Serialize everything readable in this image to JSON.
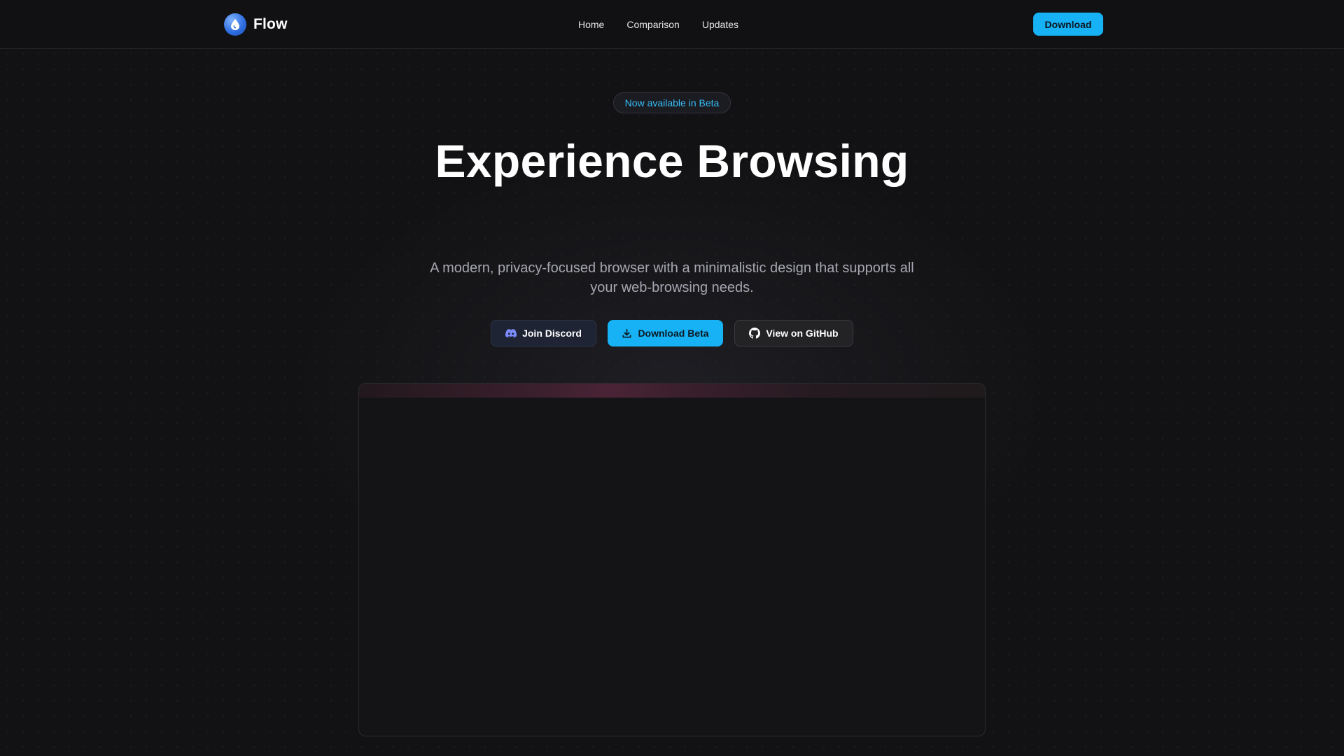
{
  "header": {
    "brand_name": "Flow",
    "nav": [
      {
        "label": "Home"
      },
      {
        "label": "Comparison"
      },
      {
        "label": "Updates"
      }
    ],
    "download_label": "Download"
  },
  "hero": {
    "badge": "Now available in Beta",
    "title": "Experience Browsing",
    "subtitle": "A modern, privacy-focused browser with a minimalistic design that supports all your web-browsing needs.",
    "buttons": {
      "discord": "Join Discord",
      "beta": "Download Beta",
      "github": "View on GitHub"
    }
  },
  "icons": {
    "brand": "droplet-logo-icon",
    "discord": "discord-icon",
    "download": "download-icon",
    "github": "github-icon"
  },
  "colors": {
    "accent": "#16b2f5",
    "badge_text": "#38bdf8",
    "background": "#121214"
  }
}
